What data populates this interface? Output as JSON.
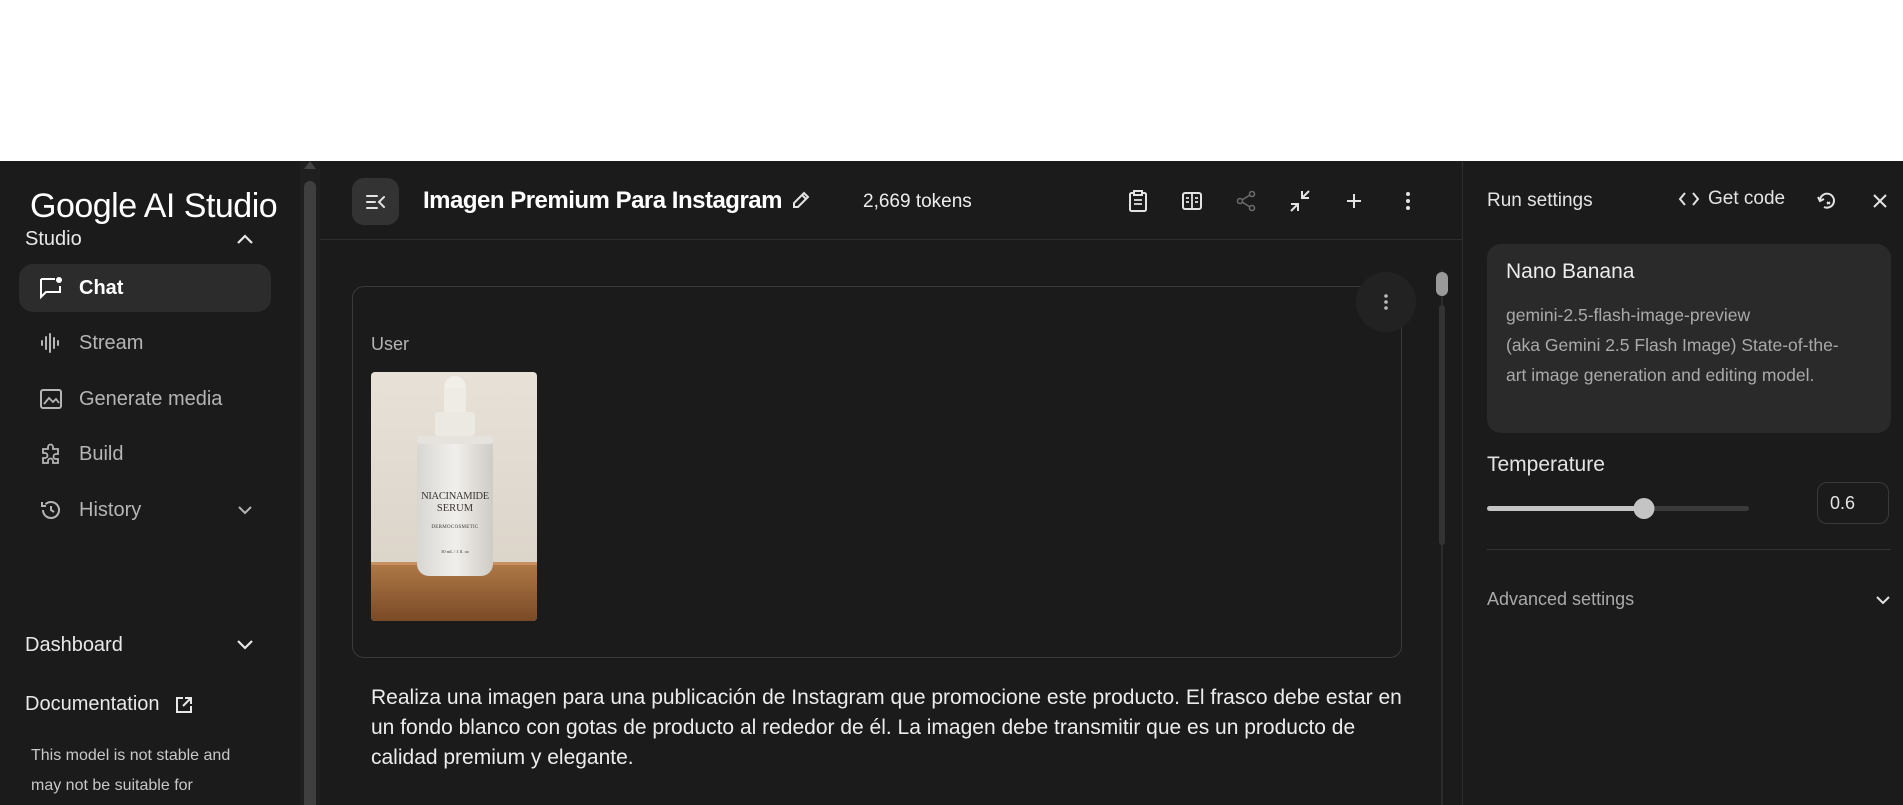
{
  "sidebar": {
    "logo": "Google AI Studio",
    "studio_label": "Studio",
    "items": [
      {
        "label": "Chat",
        "icon": "chat-icon",
        "active": true
      },
      {
        "label": "Stream",
        "icon": "stream-icon"
      },
      {
        "label": "Generate media",
        "icon": "image-icon"
      },
      {
        "label": "Build",
        "icon": "puzzle-icon"
      },
      {
        "label": "History",
        "icon": "history-icon"
      }
    ],
    "dashboard_label": "Dashboard",
    "documentation_label": "Documentation",
    "note": "This model is not stable and may not be suitable for"
  },
  "topbar": {
    "title": "Imagen Premium Para Instagram",
    "tokens": "2,669 tokens",
    "icons": [
      "clipboard-icon",
      "compare-icon",
      "share-icon",
      "compress-icon",
      "add-icon",
      "more-vert-icon"
    ]
  },
  "chat": {
    "role": "User",
    "image_product": {
      "line1": "NIACINAMIDE",
      "line2": "SERUM",
      "line3": "DERMOCOSMETIC",
      "line4": "30 mL / 1 fl. oz"
    },
    "prompt": "Realiza una imagen para una publicación de Instagram que promocione este producto. El frasco debe estar en un fondo blanco con gotas de producto al rededor de él. La imagen debe transmitir que es un producto de calidad premium y elegante."
  },
  "run_settings": {
    "title": "Run settings",
    "get_code": "Get code",
    "model_name": "Nano Banana",
    "model_id": "gemini-2.5-flash-image-preview",
    "model_desc": "(aka Gemini 2.5 Flash Image) State-of-the-art image generation and editing model.",
    "temperature_label": "Temperature",
    "temperature_value": "0.6",
    "temperature_fraction": 0.6,
    "advanced_label": "Advanced settings"
  },
  "colors": {
    "background": "#1b1b1b",
    "card": "#2a2a2a",
    "active_nav": "#2c2c2c",
    "text": "#e3e3e3"
  }
}
